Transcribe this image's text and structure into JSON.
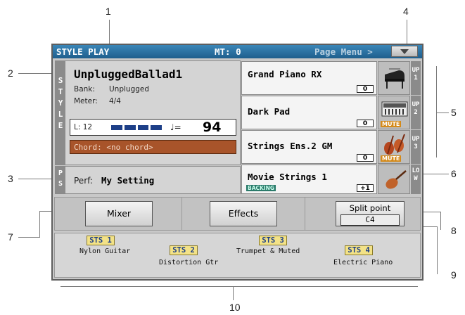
{
  "callouts": [
    "1",
    "2",
    "3",
    "4",
    "5",
    "6",
    "7",
    "8",
    "9",
    "10"
  ],
  "titlebar": {
    "title": "STYLE PLAY",
    "mt": "MT: 0",
    "page_menu": "Page Menu >"
  },
  "style_panel": {
    "tab": "STYLE",
    "name": "UnpluggedBallad1",
    "bank_label": "Bank:",
    "bank": "Unplugged",
    "meter_label": "Meter:",
    "meter": "4/4",
    "length": "L: 12",
    "tempo_prefix": "♩=",
    "tempo": "94",
    "chord": "Chord: <no chord>"
  },
  "perf_panel": {
    "tab": "PS",
    "label": "Perf:",
    "value": "My Setting"
  },
  "tracks": [
    {
      "name": "Grand Piano RX",
      "octave": "0",
      "side": "UP1",
      "muted": false,
      "icon": "grand-piano-icon"
    },
    {
      "name": "Dark Pad",
      "octave": "0",
      "side": "UP2",
      "muted": true,
      "mute_label": "MUTE",
      "icon": "synth-keyboard-icon"
    },
    {
      "name": "Strings Ens.2 GM",
      "octave": "0",
      "side": "UP3",
      "muted": true,
      "mute_label": "MUTE",
      "icon": "string-section-icon"
    },
    {
      "name": "Movie Strings 1",
      "octave": "+1",
      "side": "LOW",
      "badge": "BACKING",
      "icon": "violin-icon"
    }
  ],
  "buttons": {
    "mixer": "Mixer",
    "effects": "Effects",
    "split_label": "Split point",
    "split_value": "C4"
  },
  "sts": [
    {
      "label": "STS 1",
      "name": "Nylon Guitar"
    },
    {
      "label": "STS 2",
      "name": "Distortion Gtr"
    },
    {
      "label": "STS 3",
      "name": "Trumpet & Muted"
    },
    {
      "label": "STS 4",
      "name": "Electric Piano"
    }
  ],
  "colors": {
    "title_bar": "#1f5f8d",
    "chord_bg": "#a8542a",
    "sts_bg": "#f3e287",
    "mute": "#d48a1a"
  }
}
